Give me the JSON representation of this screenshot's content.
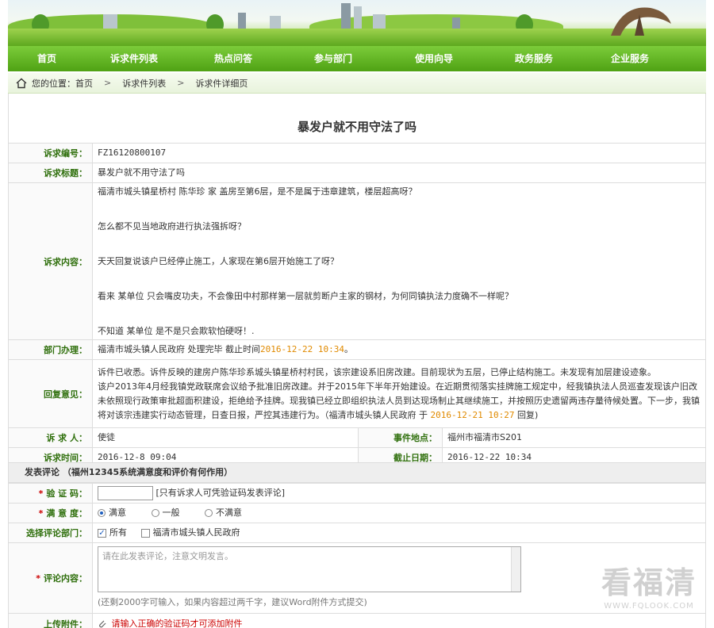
{
  "nav": {
    "items": [
      "首页",
      "诉求件列表",
      "热点问答",
      "参与部门",
      "使用向导",
      "政务服务",
      "企业服务"
    ]
  },
  "breadcrumb": {
    "prefix": "您的位置：首页",
    "items": [
      "诉求件列表",
      "诉求件详细页"
    ]
  },
  "page_title": "暴发户就不用守法了吗",
  "detail": {
    "number_label": "诉求编号：",
    "number": "FZ16120800107",
    "subject_label": "诉求标题：",
    "subject": "暴发户就不用守法了吗",
    "content_label": "诉求内容：",
    "content": [
      "福清市城头镇星桥村 陈华珍 家 盖房至第6层，是不是属于违章建筑，楼层超高呀？",
      "怎么都不见当地政府进行执法强拆呀？",
      "天天回复说该户已经停止施工，人家现在第6层开始施工了呀？",
      "看来 某单位 只会嘴皮功夫，不会像田中村那样第一层就剪断户主家的钢材，为何同镇执法力度确不一样呢？",
      "不知道 某单位 是不是只会欺软怕硬呀！."
    ],
    "dept_label": "部门办理：",
    "dept_text": "福清市城头镇人民政府 处理完毕 截止时间",
    "dept_deadline": "2016-12-22 10:34",
    "dept_suffix": "。",
    "reply_label": "回复意见：",
    "reply_p1": "诉件已收悉。诉件反映的建房户陈华珍系城头镇星桥村村民，该宗建设系旧房改建。目前现状为五层，已停止结构施工。未发现有加层建设迹象。",
    "reply_p2": "该户2013年4月经我镇党政联席会议给予批准旧房改建。并于2015年下半年开始建设。在近期贯彻落实挂牌施工规定中，经我镇执法人员巡查发现该户旧改未依照现行政策审批超面积建设，拒绝给予挂牌。现我镇已经立即组织执法人员到达现场制止其继续施工，并按照历史遗留两违存量待候处置。下一步，我镇将对该宗违建实行动态管理，日查日报，严控其违建行为。（福清市城头镇人民政府 于",
    "reply_date": "2016-12-21 10:27",
    "reply_suffix": "回复)",
    "petitioner_label": "诉 求 人：",
    "petitioner": "使徒",
    "location_label": "事件地点：",
    "location": "福州市福清市S201",
    "time_label": "诉求时间：",
    "time": "2016-12-8 09:04",
    "deadline_label": "截止日期：",
    "deadline": "2016-12-22 10:34"
  },
  "comment": {
    "heading": "发表评论 （福州12345系统满意度和评价有何作用）",
    "captcha_label": "验 证 码：",
    "captcha_note": "[只有诉求人可凭验证码发表评论]",
    "rating_label": "满 意 度：",
    "ratings": [
      "满意",
      "一般",
      "不满意"
    ],
    "dept_select_label": "选择评论部门：",
    "dept_options": [
      "所有",
      "福清市城头镇人民政府"
    ],
    "content_label": "评论内容：",
    "placeholder": "请在此发表评论，注意文明发言。",
    "hint": "(还剩2000字可输入，如果内容超过两千字，建议Word附件方式提交)",
    "attach_label": "上传附件：",
    "attach_note": "请输入正确的验证码才可添加附件"
  },
  "watermark": {
    "text": "看福清",
    "url": "WWW.FQLOOK.COM"
  }
}
